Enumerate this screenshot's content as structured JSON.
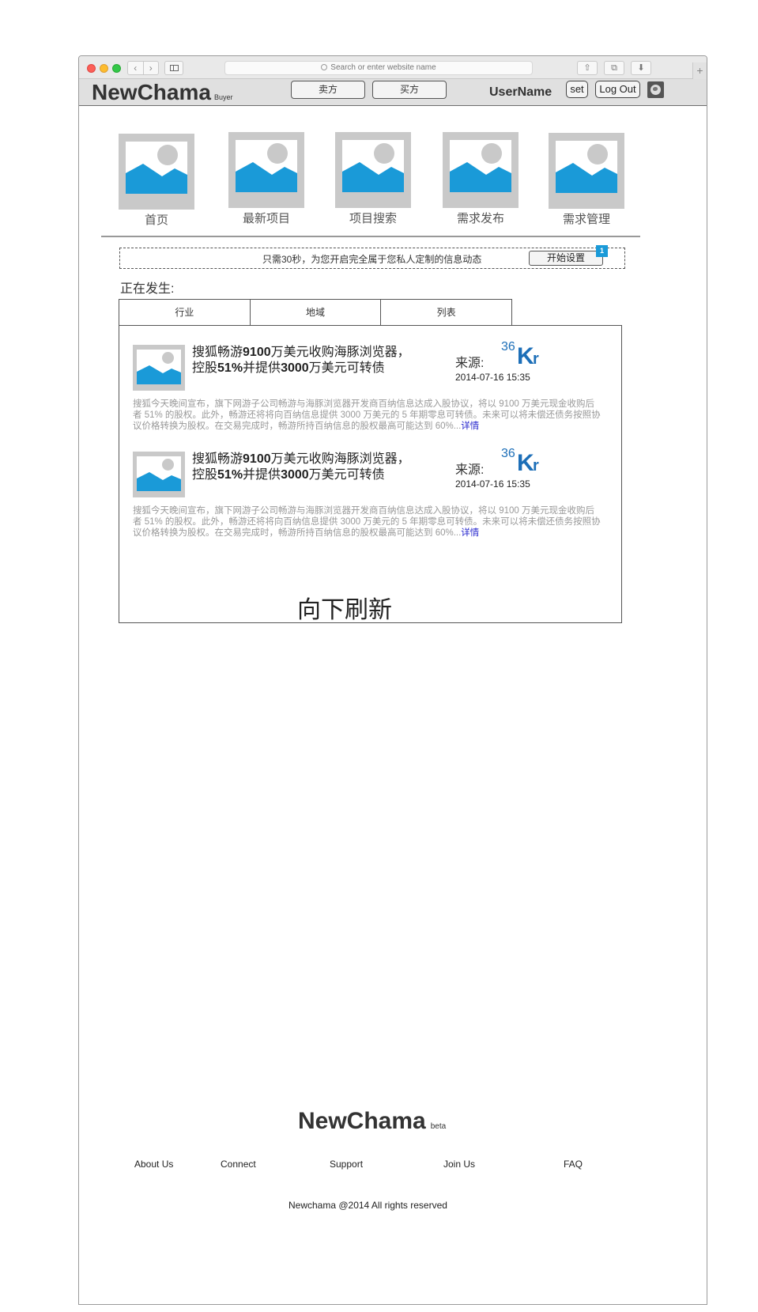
{
  "browser": {
    "url_placeholder": "Search or enter website name",
    "back": "‹",
    "forward": "›",
    "share": "⇧",
    "tabs": "⧉",
    "download": "⬇",
    "new_tab": "+"
  },
  "header": {
    "logo": "NewChama",
    "logo_sub": "Buyer",
    "seller_button": "卖方",
    "buyer_button": "买方",
    "username": "UserName",
    "set_button": "set",
    "logout_button": "Log Out"
  },
  "nav": {
    "items": [
      {
        "label": "首页"
      },
      {
        "label": "最新项目"
      },
      {
        "label": "项目搜索"
      },
      {
        "label": "需求发布"
      },
      {
        "label": "需求管理"
      }
    ]
  },
  "banner": {
    "text": "只需30秒，为您开启完全属于您私人定制的信息动态",
    "button": "开始设置",
    "badge": "1"
  },
  "feed": {
    "heading": "正在发生:",
    "tabs": [
      "行业",
      "地域",
      "列表"
    ],
    "articles": [
      {
        "title_parts": [
          "搜狐畅游",
          "9100",
          "万美元收购海豚浏览器，控股",
          "51%",
          "并提供",
          "3000",
          "万美元可转债"
        ],
        "source_label": "来源:",
        "source_logo": "36Kr",
        "date": "2014-07-16 15:35",
        "body": "搜狐今天晚间宣布，旗下网游子公司畅游与海豚浏览器开发商百纳信息达成入股协议，将以 9100 万美元现金收购后者 51% 的股权。此外，畅游还将将向百纳信息提供 3000 万美元的 5 年期零息可转债。未来可以将未偿还债务按照协议价格转换为股权。在交易完成时，畅游所持百纳信息的股权最高可能达到 60%...",
        "more": "详情"
      },
      {
        "title_parts": [
          "搜狐畅游",
          "9100",
          "万美元收购海豚浏览器，控股",
          "51%",
          "并提供",
          "3000",
          "万美元可转债"
        ],
        "source_label": "来源:",
        "source_logo": "36Kr",
        "date": "2014-07-16 15:35",
        "body": "搜狐今天晚间宣布，旗下网游子公司畅游与海豚浏览器开发商百纳信息达成入股协议，将以 9100 万美元现金收购后者 51% 的股权。此外，畅游还将将向百纳信息提供 3000 万美元的 5 年期零息可转债。未来可以将未偿还债务按照协议价格转换为股权。在交易完成时，畅游所持百纳信息的股权最高可能达到 60%...",
        "more": "详情"
      }
    ],
    "refresh": "向下刷新"
  },
  "footer": {
    "logo": "NewChama",
    "logo_sub": "beta",
    "links": [
      "About Us",
      "Connect",
      "Support",
      "Join Us",
      "FAQ"
    ],
    "copyright": "Newchama @2014 All rights reserved"
  },
  "colors": {
    "accent_blue": "#1a9ad8",
    "kr_blue": "#1d6fb8",
    "link_blue": "#2222cc"
  }
}
